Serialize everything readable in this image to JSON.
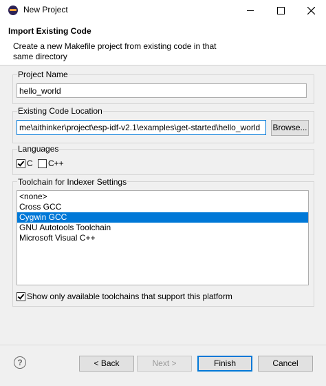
{
  "window": {
    "title": "New Project"
  },
  "header": {
    "title": "Import Existing Code",
    "description": "Create a new Makefile project from existing code in that same directory"
  },
  "project_name": {
    "label": "Project Name",
    "value": "hello_world"
  },
  "code_location": {
    "label": "Existing Code Location",
    "value": "me\\aithinker\\project\\esp-idf-v2.1\\examples\\get-started\\hello_world",
    "browse_label": "Browse..."
  },
  "languages": {
    "label": "Languages",
    "c": {
      "label": "C",
      "checked": true
    },
    "cpp": {
      "label": "C++",
      "checked": false
    }
  },
  "toolchain": {
    "label": "Toolchain for Indexer Settings",
    "items": [
      {
        "label": "<none>",
        "selected": false
      },
      {
        "label": "Cross GCC",
        "selected": false
      },
      {
        "label": "Cygwin GCC",
        "selected": true
      },
      {
        "label": "GNU Autotools Toolchain",
        "selected": false
      },
      {
        "label": "Microsoft Visual C++",
        "selected": false
      }
    ],
    "show_only_label": "Show only available toolchains that support this platform",
    "show_only_checked": true
  },
  "footer": {
    "help_glyph": "?",
    "back_label": "< Back",
    "next_label": "Next >",
    "finish_label": "Finish",
    "cancel_label": "Cancel"
  }
}
